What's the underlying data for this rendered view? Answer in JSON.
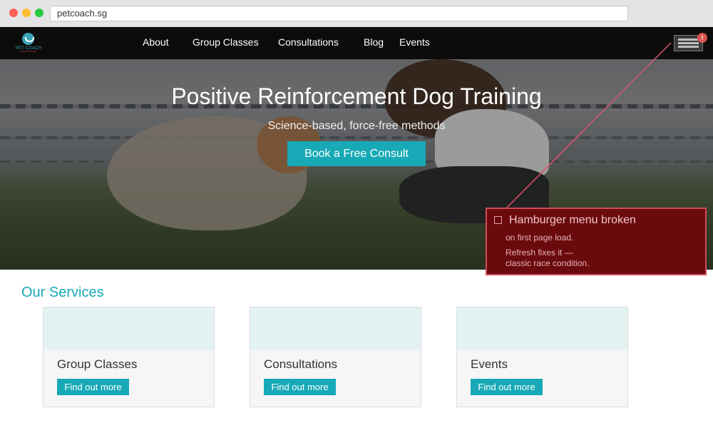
{
  "browser": {
    "url": "petcoach.sg"
  },
  "nav": {
    "logo_text": "PET COACH",
    "logo_subtext": "SINGAPORE",
    "links": [
      "About",
      "Group Classes",
      "Consultations",
      "Blog",
      "Events"
    ],
    "menu_badge": "!"
  },
  "hero": {
    "title": "Positive Reinforcement Dog Training",
    "subtitle": "Science-based, force-free methods",
    "cta_label": "Book a Free Consult"
  },
  "bug_note": {
    "title": "Hamburger menu broken",
    "line1": "on first page load.",
    "line2": "Refresh fixes it —",
    "line3": "classic race condition."
  },
  "services": {
    "heading": "Our Services",
    "cards": [
      {
        "title": "Group Classes",
        "button": "Find out more"
      },
      {
        "title": "Consultations",
        "button": "Find out more"
      },
      {
        "title": "Events",
        "button": "Find out more"
      }
    ]
  },
  "colors": {
    "accent": "#17a9b6",
    "nav_background": "#0c0c0c",
    "bug_card": "#6a0a0c"
  }
}
